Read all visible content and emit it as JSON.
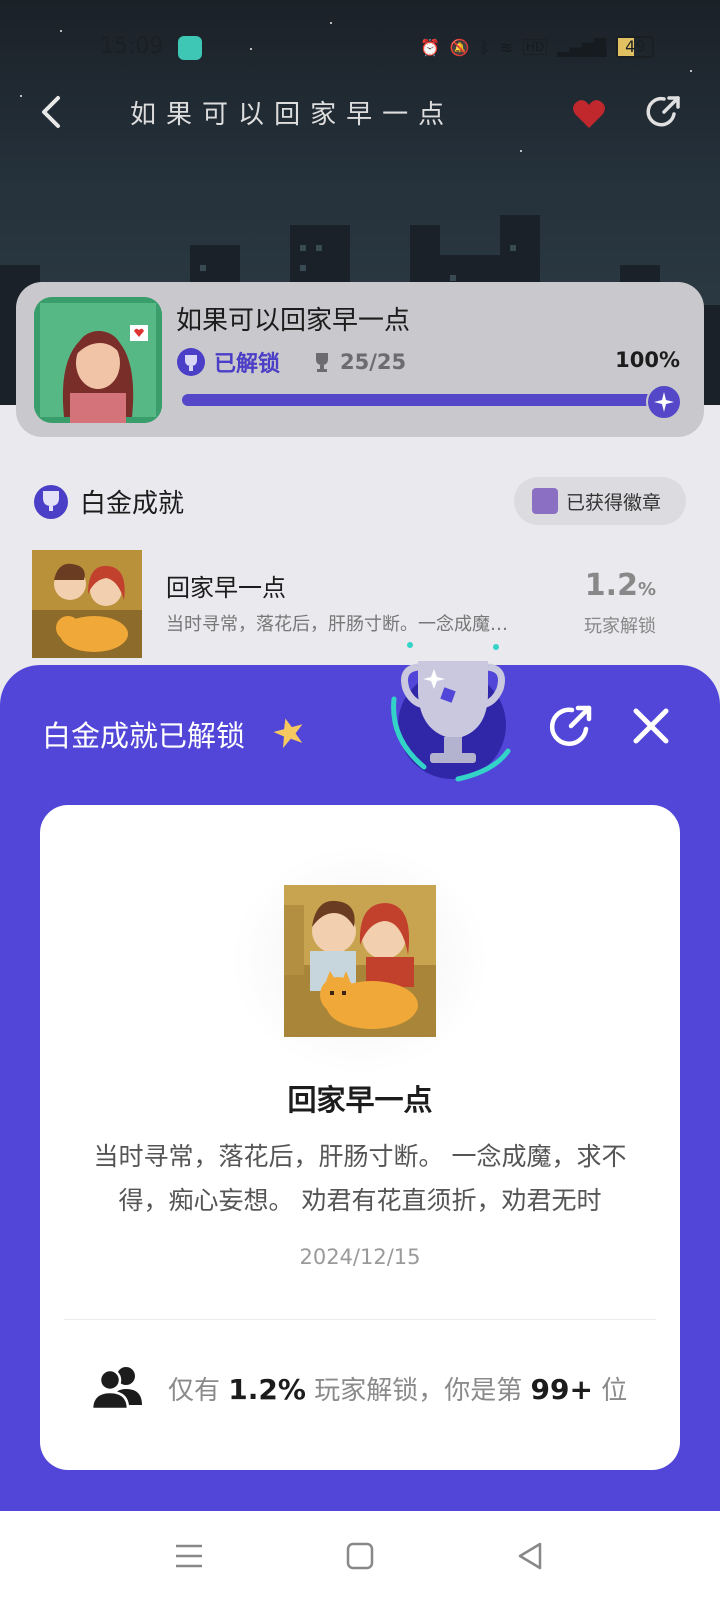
{
  "status_bar": {
    "time": "15:09",
    "battery": "49"
  },
  "header": {
    "title_pixel": [
      "如",
      "果",
      "可",
      "以",
      "回",
      "家",
      "早",
      "一",
      "点"
    ],
    "back_icon": "chevron-left-icon",
    "heart_icon": "heart-icon",
    "share_icon": "share-icon"
  },
  "game_card": {
    "title": "如果可以回家早一点",
    "unlock_status": "已解锁",
    "trophy_count": "25/25",
    "progress_percent": "100%",
    "progress_value": 1.0
  },
  "section": {
    "title": "白金成就",
    "badge_pill_label": "已获得徽章"
  },
  "list_item": {
    "title": "回家早一点",
    "description": "当时寻常，落花后，肝肠寸断。一念成魔…",
    "percent": "1.2",
    "percent_unit": "%",
    "sub_label": "玩家解锁"
  },
  "sheet": {
    "title": "白金成就已解锁",
    "card": {
      "title": "回家早一点",
      "description": "当时寻常，落花后，肝肠寸断。 一念成魔，求不得，痴心妄想。 劝君有花直须折，劝君无时",
      "date": "2024/12/15",
      "footer_prefix": "仅有",
      "footer_percent": "1.2%",
      "footer_middle": "玩家解锁，你是第",
      "footer_rank": "99+",
      "footer_suffix": "位"
    }
  },
  "colors": {
    "accent": "#5246d8",
    "progress": "#5448c8"
  }
}
